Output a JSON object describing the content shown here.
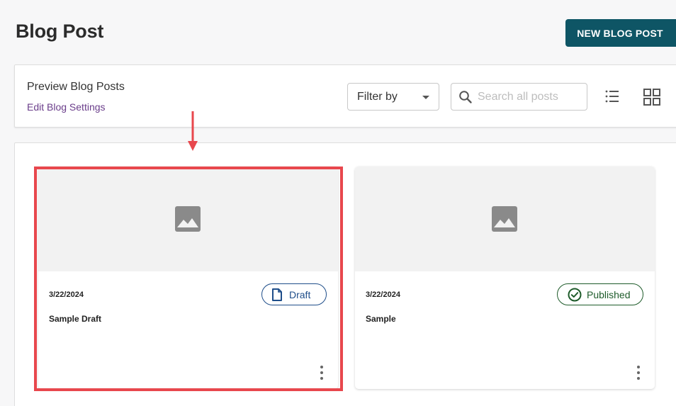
{
  "header": {
    "title": "Blog Post",
    "new_post_label": "NEW BLOG POST"
  },
  "toolbar": {
    "preview_label": "Preview Blog Posts",
    "settings_link": "Edit Blog Settings",
    "filter_label": "Filter by",
    "search_placeholder": "Search all posts",
    "icons": [
      "search-icon",
      "list-view-icon",
      "grid-view-icon"
    ]
  },
  "cards": [
    {
      "date": "3/22/2024",
      "title": "Sample Draft",
      "status": "Draft",
      "status_color": "#1f4e8a",
      "image_icon": "image-placeholder-icon"
    },
    {
      "date": "3/22/2024",
      "title": "Sample",
      "status": "Published",
      "status_color": "#1e5b2a",
      "image_icon": "image-placeholder-icon"
    }
  ],
  "colors": {
    "primary_button": "#0e5565",
    "link": "#6a3d8a",
    "annotation": "#e8474d"
  }
}
